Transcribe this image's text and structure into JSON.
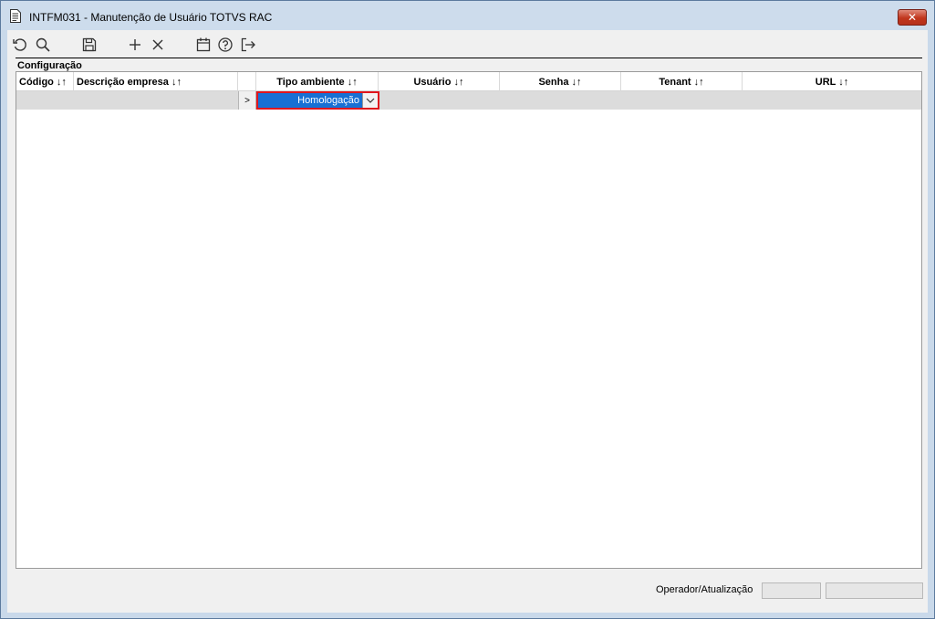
{
  "window": {
    "title": "INTFM031 - Manutenção de Usuário TOTVS RAC",
    "close_label": "✕"
  },
  "toolbar": {
    "buttons": [
      {
        "name": "refresh-icon"
      },
      {
        "name": "search-icon"
      },
      {
        "name": "save-icon"
      },
      {
        "name": "add-icon"
      },
      {
        "name": "delete-icon"
      },
      {
        "name": "calendar-icon"
      },
      {
        "name": "help-icon"
      },
      {
        "name": "exit-icon"
      }
    ]
  },
  "section": {
    "label": "Configuração"
  },
  "grid": {
    "columns": [
      "Código ↓↑",
      "Descrição empresa ↓↑",
      "",
      "Tipo ambiente ↓↑",
      "Usuário ↓↑",
      "Senha ↓↑",
      "Tenant ↓↑",
      "URL ↓↑"
    ],
    "row": {
      "indicator": ">",
      "tipo_ambiente": "Homologação"
    }
  },
  "footer": {
    "label": "Operador/Atualização",
    "operador": "",
    "atualizacao": ""
  }
}
